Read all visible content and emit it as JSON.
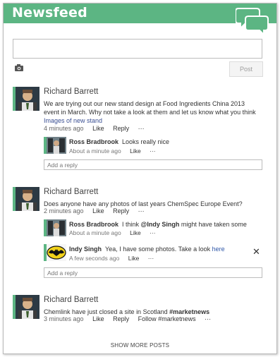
{
  "header": {
    "title": "Newsfeed"
  },
  "composer": {
    "placeholder": "",
    "post_label": "Post",
    "camera_icon": "camera-icon"
  },
  "posts": [
    {
      "author": "Richard Barrett",
      "text": "We are trying out our new stand design at Food Ingredients China 2013 event in March. Why not take a look at them and let us know what you think ",
      "link": "Images of new stand",
      "time": "4 minutes ago",
      "like": "Like",
      "reply": "Reply",
      "more": "···",
      "comments": [
        {
          "author": "Ross Bradbrook",
          "text": "Looks really nice",
          "time": "About a minute ago",
          "like": "Like",
          "more": "···"
        }
      ],
      "reply_placeholder": "Add a reply"
    },
    {
      "author": "Richard Barrett",
      "text": "Does anyone have any photos of last years ChemSpec Europe Event?",
      "time": "2 minutes ago",
      "like": "Like",
      "reply": "Reply",
      "more": "···",
      "comments": [
        {
          "author": "Ross Bradbrook",
          "text_pre": "I think ",
          "mention": "@Indy Singh",
          "text_post": " might have taken some",
          "time": "About a minute ago",
          "like": "Like",
          "more": "···"
        },
        {
          "author": "Indy Singh",
          "text": "Yea, I have some photos. Take a look ",
          "link": "here",
          "time": "A few seconds ago",
          "like": "Like",
          "more": "···",
          "close": "✕"
        }
      ],
      "reply_placeholder": "Add a reply"
    },
    {
      "author": "Richard Barrett",
      "text_pre": "Chemlink have just closed a site in Scotland ",
      "hashtag": "#marketnews",
      "time": "3 minutes ago",
      "like": "Like",
      "reply": "Reply",
      "follow": "Follow #marketnews",
      "more": "···"
    }
  ],
  "footer": {
    "show_more": "SHOW MORE POSTS"
  },
  "colors": {
    "accent": "#5cb583",
    "link": "#3a4f93"
  }
}
